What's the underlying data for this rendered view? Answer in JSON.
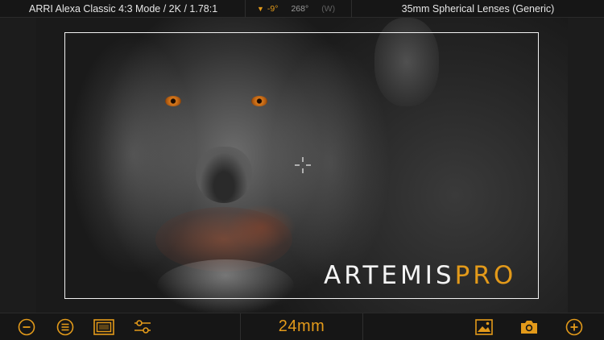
{
  "topbar": {
    "camera_format": "ARRI Alexa Classic 4:3 Mode / 2K / 1.78:1",
    "tilt_arrow": "▼",
    "tilt": "-9°",
    "heading": "268°",
    "wb": "(W)",
    "lens_set": "35mm Spherical Lenses (Generic)"
  },
  "viewport": {
    "watermark_part1": "ARTEMIS",
    "watermark_part2": "PRO"
  },
  "bottombar": {
    "focal_length": "24mm",
    "icons": [
      "zoom-out-icon",
      "menu-list-icon",
      "frame-lines-icon",
      "settings-sliders-icon",
      "gallery-image-icon",
      "camera-icon",
      "zoom-in-icon"
    ]
  },
  "colors": {
    "accent": "#e39a1a",
    "bar_background": "#161616",
    "frameline": "#f2f2f2"
  }
}
